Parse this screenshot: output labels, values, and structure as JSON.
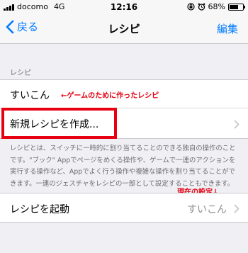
{
  "status_bar": {
    "carrier": "docomo",
    "network": "4G",
    "time": "12:16",
    "battery": "68%",
    "battery_level": 0.68
  },
  "nav": {
    "back_label": "戻る",
    "title": "レシピ",
    "edit_label": "編集"
  },
  "section": {
    "header": "レシピ",
    "recipe_name": "すいこん",
    "new_recipe_label": "新規レシピを作成...",
    "footer": "レシピとは、スイッチに一時的に割り当てることのできる独自の操作のことです。\"ブック\" Appでページをめくる操作や、ゲームで一連のアクションを実行する操作など、Appでよく行う操作や複雑な操作を割り当てることができます。一連のジェスチャをレシピの一部として設定することもできます。"
  },
  "launch": {
    "label": "レシピを起動",
    "value": "すいこん"
  },
  "annotations": {
    "recipe_note": "←ゲームのために作ったレシピ",
    "current_setting": "現在の設定↓",
    "color": "#e60012"
  },
  "colors": {
    "accent": "#007aff",
    "background": "#efeff4"
  }
}
